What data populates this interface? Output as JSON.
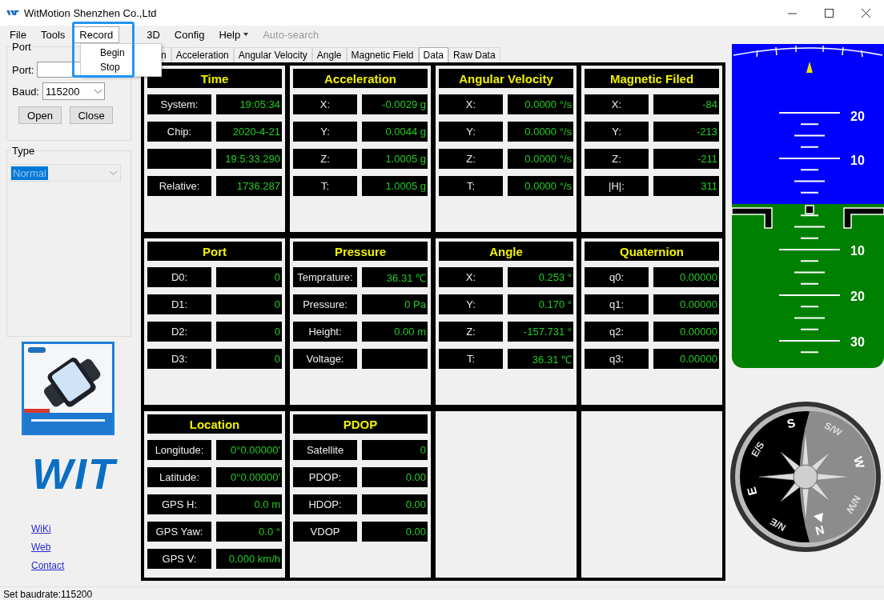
{
  "window": {
    "title": "WitMotion Shenzhen Co.,Ltd"
  },
  "menu": [
    {
      "label": "File",
      "selected": false,
      "disabled": false
    },
    {
      "label": "Tools",
      "selected": false,
      "disabled": false
    },
    {
      "label": "Record",
      "selected": true,
      "disabled": false
    },
    {
      "label": "3D",
      "selected": false,
      "disabled": false
    },
    {
      "label": "Config",
      "selected": false,
      "disabled": false
    },
    {
      "label": "Help",
      "selected": false,
      "disabled": false,
      "caret": true
    },
    {
      "label": "Auto-search",
      "selected": false,
      "disabled": true
    }
  ],
  "open_menu": {
    "items": [
      "Begin",
      "Stop"
    ]
  },
  "port_group": {
    "title": "Port",
    "port_label": "Port:",
    "baud_label": "Baud:",
    "baud_value": "115200",
    "buttons": [
      "Open",
      "Close"
    ]
  },
  "type_group": {
    "title": "Type",
    "value": "Normal"
  },
  "product_image": {
    "kind": "picture"
  },
  "logo": {
    "text": "WIT"
  },
  "links": [
    "WiKi",
    "Web",
    "Contact"
  ],
  "tabs": [
    {
      "label": "n",
      "selected": false
    },
    {
      "label": "Acceleration",
      "selected": false
    },
    {
      "label": "Angular Velocity",
      "selected": false
    },
    {
      "label": "Angle",
      "selected": false
    },
    {
      "label": "Magnetic Field",
      "selected": false
    },
    {
      "label": "Data",
      "selected": true
    },
    {
      "label": "Raw Data",
      "selected": false
    }
  ],
  "panels": [
    {
      "title": "Time",
      "rows": [
        {
          "label": "System:",
          "value": "19:05:34"
        },
        {
          "label": "Chip:",
          "value": "2020-4-21"
        },
        {
          "value": "19:5:33.290"
        },
        {
          "label": "Relative:",
          "value": "1736.287"
        }
      ]
    },
    {
      "title": "Acceleration",
      "rows": [
        {
          "label": "X:",
          "value": "-0.0029 g"
        },
        {
          "label": "Y:",
          "value": "0.0044 g"
        },
        {
          "label": "Z:",
          "value": "1.0005 g"
        },
        {
          "label": "T:",
          "value": "1.0005 g"
        }
      ]
    },
    {
      "title": "Angular Velocity",
      "rows": [
        {
          "label": "X:",
          "value": "0.0000 °/s"
        },
        {
          "label": "Y:",
          "value": "0.0000 °/s"
        },
        {
          "label": "Z:",
          "value": "0.0000 °/s"
        },
        {
          "label": "T:",
          "value": "0.0000 °/s"
        }
      ]
    },
    {
      "title": "Magnetic Filed",
      "rows": [
        {
          "label": "X:",
          "value": "-84"
        },
        {
          "label": "Y:",
          "value": "-213"
        },
        {
          "label": "Z:",
          "value": "-211"
        },
        {
          "label": "|H|:",
          "value": "311"
        }
      ]
    },
    {
      "title": "Port",
      "rows": [
        {
          "label": "D0:",
          "value": "0"
        },
        {
          "label": "D1:",
          "value": "0"
        },
        {
          "label": "D2:",
          "value": "0"
        },
        {
          "label": "D3:",
          "value": "0"
        }
      ]
    },
    {
      "title": "Pressure",
      "rows": [
        {
          "label": "Temprature:",
          "value": "36.31 ℃"
        },
        {
          "label": "Pressure:",
          "value": "0 Pa"
        },
        {
          "label": "Height:",
          "value": "0.00 m"
        },
        {
          "label": "Voltage:"
        }
      ]
    },
    {
      "title": "Angle",
      "rows": [
        {
          "label": "X:",
          "value": "0.253 °"
        },
        {
          "label": "Y:",
          "value": "0.170 °"
        },
        {
          "label": "Z:",
          "value": "-157.731 °"
        },
        {
          "label": "T:",
          "value": "36.31 ℃"
        }
      ]
    },
    {
      "title": "Quaternion",
      "rows": [
        {
          "label": "q0:",
          "value": "0.00000"
        },
        {
          "label": "q1:",
          "value": "0.00000"
        },
        {
          "label": "q2:",
          "value": "0.00000"
        },
        {
          "label": "q3:",
          "value": "0.00000"
        }
      ]
    },
    {
      "title": "Location",
      "rows": [
        {
          "label": "Longitude:",
          "value": "0°0.00000'"
        },
        {
          "label": "Latitude:",
          "value": "0°0.00000'"
        },
        {
          "label": "GPS H:",
          "value": "0.0 m"
        },
        {
          "label": "GPS Yaw:",
          "value": "0.0 °"
        },
        {
          "label": "GPS V:",
          "value": "0.000 km/h"
        }
      ]
    },
    {
      "title": "PDOP",
      "rows": [
        {
          "label": "Satellite",
          "value": "0"
        },
        {
          "label": "PDOP:",
          "value": "0.00"
        },
        {
          "label": "HDOP:",
          "value": "0.00"
        },
        {
          "label": "VDOP",
          "value": "0.00"
        }
      ]
    },
    {
      "kind": "empty"
    },
    {
      "kind": "empty"
    }
  ],
  "attitude": {
    "pitch_labels": [
      "20",
      "10",
      "10",
      "20",
      "30"
    ]
  },
  "compass": {
    "labels": [
      "S",
      "S/W",
      "W",
      "N/W",
      "N",
      "N/E",
      "E",
      "E/S"
    ]
  },
  "status_bar": {
    "text": "Set baudrate:115200"
  }
}
